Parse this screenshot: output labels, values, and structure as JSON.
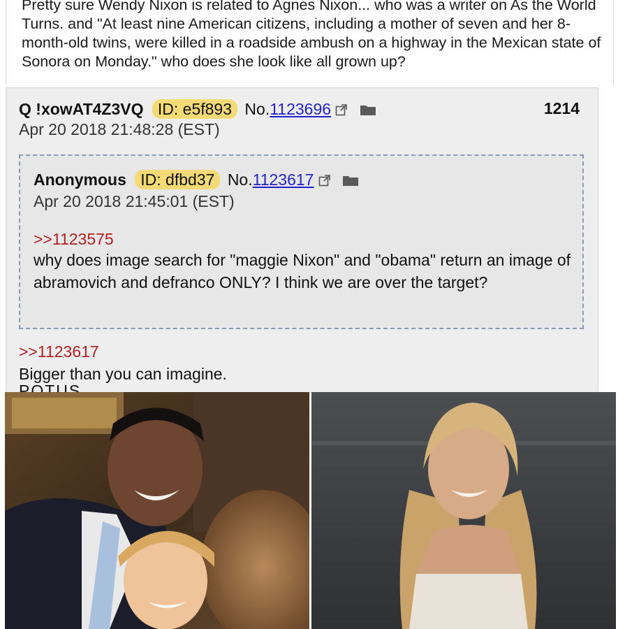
{
  "caption": {
    "text": "Pretty sure Wendy Nixon is related to Agnes Nixon... who was a writer on As the World Turns. and \"At least nine American citizens, including a mother of seven and her 8-month-old twins, were killed in a roadside ambush on a highway in the Mexican state of Sonora on Monday.\"  who does she look like all grown up?"
  },
  "post": {
    "author": "Q !xowAT4Z3VQ",
    "id_label": "ID: e5f893",
    "no_prefix": "No.",
    "number": "1123696",
    "reply_count": "1214",
    "timestamp": "Apr 20 2018 21:48:28 (EST)",
    "quoted": {
      "author": "Anonymous",
      "id_label": "ID: dfbd37",
      "no_prefix": "No.",
      "number": "1123617",
      "timestamp": "Apr 20 2018 21:45:01 (EST)",
      "reference": ">>1123575",
      "body": "why does image search for \"maggie Nixon\" and \"obama\" return an image of abramovich and defranco ONLY? I think we are over the target?"
    },
    "reply_reference": ">>1123617",
    "reply_text": "Bigger than you can imagine.",
    "reply_truncated": "POTUS ..."
  },
  "photos": [
    {
      "subject": "man-in-suit-with-young-girl"
    },
    {
      "subject": "smiling-blonde-woman"
    }
  ],
  "colors": {
    "id_badge": "#f4da74",
    "link_blue": "#2222cc",
    "quote_red": "#b22222",
    "post_bg": "#eeeeee"
  }
}
